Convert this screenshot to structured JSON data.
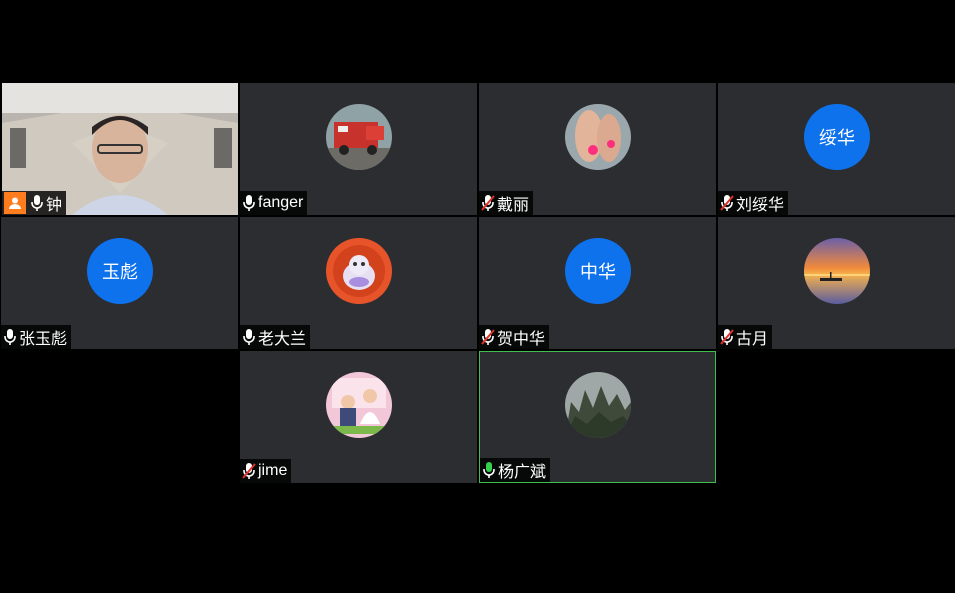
{
  "colors": {
    "background": "#000000",
    "tile": "#2b2d31",
    "avatar_blue": "#0e72ed",
    "host_orange": "#ff7c1f",
    "active_border": "#3fbf4f",
    "muted_red": "#e0322a",
    "speaking_green": "#35d04d"
  },
  "participants": [
    {
      "name": "钟",
      "type": "video",
      "host": true,
      "mic": "on"
    },
    {
      "name": "fanger",
      "type": "photo",
      "photo_icon": "fire-truck-photo",
      "mic": "on"
    },
    {
      "name": "戴丽",
      "type": "photo",
      "photo_icon": "feet-photo",
      "mic": "muted"
    },
    {
      "name": "刘绥华",
      "type": "initials",
      "initials": "绥华",
      "mic": "muted"
    },
    {
      "name": "张玉彪",
      "type": "initials",
      "initials": "玉彪",
      "mic": "on"
    },
    {
      "name": "老大兰",
      "type": "photo",
      "photo_icon": "plush-toy-photo",
      "mic": "on"
    },
    {
      "name": "贺中华",
      "type": "initials",
      "initials": "中华",
      "mic": "muted"
    },
    {
      "name": "古月",
      "type": "photo",
      "photo_icon": "sunset-boat-photo",
      "mic": "muted"
    },
    {
      "name": "jime",
      "type": "photo",
      "photo_icon": "children-photo",
      "mic": "muted"
    },
    {
      "name": "杨广斌",
      "type": "photo",
      "photo_icon": "mountain-photo",
      "mic": "speaking",
      "active": true
    }
  ]
}
